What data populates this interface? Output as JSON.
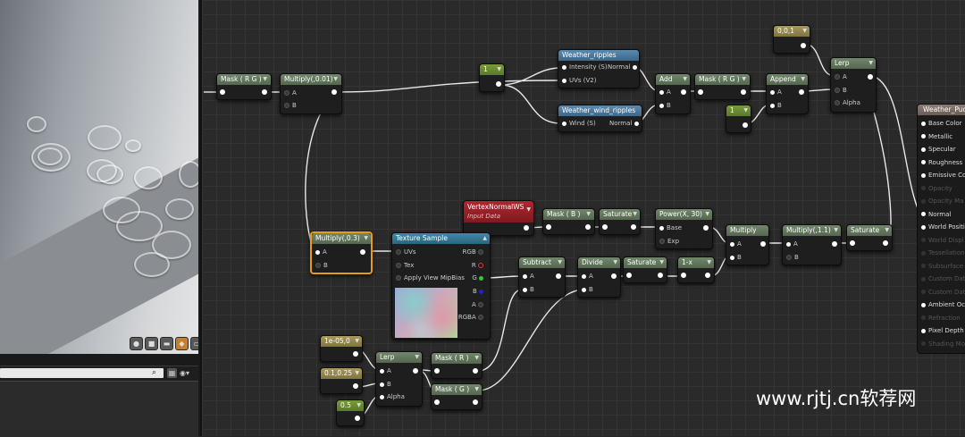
{
  "viewport_toolbar": {
    "icons": [
      "sphere-icon",
      "cube-icon",
      "cylinder-icon",
      "teapot-icon",
      "plane-icon"
    ]
  },
  "nodes": {
    "mask_rg_1": {
      "title": "Mask ( R G )"
    },
    "multiply_01": {
      "title": "Multiply(,0.01)",
      "pins": [
        "A",
        "B"
      ]
    },
    "const_1a": {
      "title": "1"
    },
    "weather_ripples": {
      "title": "Weather_ripples",
      "pins": [
        "Intensity (S)",
        "UVs (V2)"
      ],
      "output": "Normal"
    },
    "weather_wind": {
      "title": "Weather_wind_ripples",
      "pins": [
        "Wind (S)"
      ],
      "output": "Normal"
    },
    "add": {
      "title": "Add",
      "pins": [
        "A",
        "B"
      ]
    },
    "mask_rg_2": {
      "title": "Mask ( R G )"
    },
    "append": {
      "title": "Append",
      "pins": [
        "A",
        "B"
      ]
    },
    "const_1b": {
      "title": "1"
    },
    "const_001": {
      "title": "0,0,1"
    },
    "lerp_top": {
      "title": "Lerp",
      "pins": [
        "A",
        "B",
        "Alpha"
      ]
    },
    "vertex_normal": {
      "title": "VertexNormalWS",
      "subtitle": "Input Data"
    },
    "mask_b": {
      "title": "Mask ( B )"
    },
    "saturate_1": {
      "title": "Saturate"
    },
    "power": {
      "title": "Power(X, 30)",
      "pins": [
        "Base",
        "Exp"
      ]
    },
    "multiply_mid": {
      "title": "Multiply",
      "pins": [
        "A",
        "B"
      ]
    },
    "multiply_11": {
      "title": "Multiply(,1.1)",
      "pins": [
        "A",
        "B"
      ]
    },
    "saturate_2": {
      "title": "Saturate"
    },
    "multiply_03": {
      "title": "Multiply(,0.3)",
      "pins": [
        "A",
        "B"
      ]
    },
    "texture_sample": {
      "title": "Texture Sample",
      "pins": [
        "UVs",
        "Tex",
        "Apply View MipBias"
      ],
      "outputs": [
        "RGB",
        "R",
        "G",
        "B",
        "A",
        "RGBA"
      ]
    },
    "subtract": {
      "title": "Subtract",
      "pins": [
        "A",
        "B"
      ]
    },
    "divide": {
      "title": "Divide",
      "pins": [
        "A",
        "B"
      ]
    },
    "saturate_3": {
      "title": "Saturate"
    },
    "one_minus": {
      "title": "1-x"
    },
    "const_1e05": {
      "title": "1e-05,0"
    },
    "const_01025": {
      "title": "0.1,0.25"
    },
    "const_05": {
      "title": "0.5"
    },
    "lerp_bottom": {
      "title": "Lerp",
      "pins": [
        "A",
        "B",
        "Alpha"
      ]
    },
    "mask_r": {
      "title": "Mask ( R )"
    },
    "mask_g": {
      "title": "Mask ( G )"
    }
  },
  "result_node": {
    "title": "Weather_Pudd",
    "pins": [
      {
        "label": "Base Color",
        "active": true
      },
      {
        "label": "Metallic",
        "active": true
      },
      {
        "label": "Specular",
        "active": true
      },
      {
        "label": "Roughness",
        "active": true
      },
      {
        "label": "Emissive Co",
        "active": true
      },
      {
        "label": "Opacity",
        "active": false
      },
      {
        "label": "Opacity Ma",
        "active": false
      },
      {
        "label": "Normal",
        "active": true
      },
      {
        "label": "World Positi",
        "active": true
      },
      {
        "label": "World Displ",
        "active": false
      },
      {
        "label": "Tessellation",
        "active": false
      },
      {
        "label": "Subsurface",
        "active": false
      },
      {
        "label": "Custom Data",
        "active": false
      },
      {
        "label": "Custom Data",
        "active": false
      },
      {
        "label": "Ambient Occ",
        "active": true
      },
      {
        "label": "Refraction",
        "active": false
      },
      {
        "label": "Pixel Depth O",
        "active": true
      },
      {
        "label": "Shading Mo",
        "active": false
      }
    ]
  },
  "watermark": "www.rjtj.cn软荐网"
}
